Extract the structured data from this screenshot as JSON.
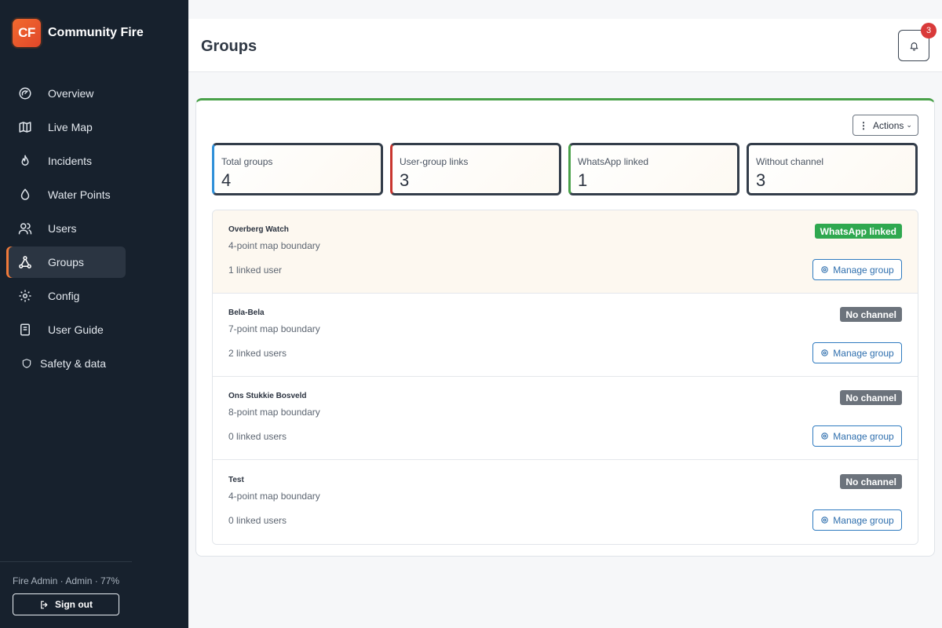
{
  "app": {
    "logo_text": "CF",
    "name": "Community Fire"
  },
  "nav": [
    {
      "label": "Overview",
      "icon": "gauge-icon"
    },
    {
      "label": "Live Map",
      "icon": "map-icon"
    },
    {
      "label": "Incidents",
      "icon": "flame-icon"
    },
    {
      "label": "Water Points",
      "icon": "droplet-icon"
    },
    {
      "label": "Users",
      "icon": "users-icon"
    },
    {
      "label": "Groups",
      "icon": "network-icon",
      "active": true
    },
    {
      "label": "Config",
      "icon": "gear-icon"
    },
    {
      "label": "User Guide",
      "icon": "book-icon"
    },
    {
      "label": "Safety & data",
      "icon": "shield-icon"
    }
  ],
  "footer": {
    "user_line": "Fire Admin · Admin · 77%",
    "sign_out": "Sign out"
  },
  "header": {
    "title": "Groups",
    "notification_count": "3"
  },
  "toolbar": {
    "actions_label": "Actions"
  },
  "stats": [
    {
      "label": "Total groups",
      "value": "4",
      "accent": "#2f8fd8"
    },
    {
      "label": "User-group links",
      "value": "3",
      "accent": "#c9362f"
    },
    {
      "label": "WhatsApp linked",
      "value": "1",
      "accent": "#4aa14a"
    },
    {
      "label": "Without channel",
      "value": "3",
      "accent": "#333d4a"
    }
  ],
  "groups": [
    {
      "name": "Overberg Watch",
      "boundary": "4-point map boundary",
      "linked": "1 linked user",
      "status": "WhatsApp linked",
      "status_color": "#2fa84f",
      "manage": "Manage group"
    },
    {
      "name": "Bela-Bela",
      "boundary": "7-point map boundary",
      "linked": "2 linked users",
      "status": "No channel",
      "status_color": "#6c737c",
      "manage": "Manage group"
    },
    {
      "name": "Ons Stukkie Bosveld",
      "boundary": "8-point map boundary",
      "linked": "0 linked users",
      "status": "No channel",
      "status_color": "#6c737c",
      "manage": "Manage group"
    },
    {
      "name": "Test",
      "boundary": "4-point map boundary",
      "linked": "0 linked users",
      "status": "No channel",
      "status_color": "#6c737c",
      "manage": "Manage group"
    }
  ]
}
